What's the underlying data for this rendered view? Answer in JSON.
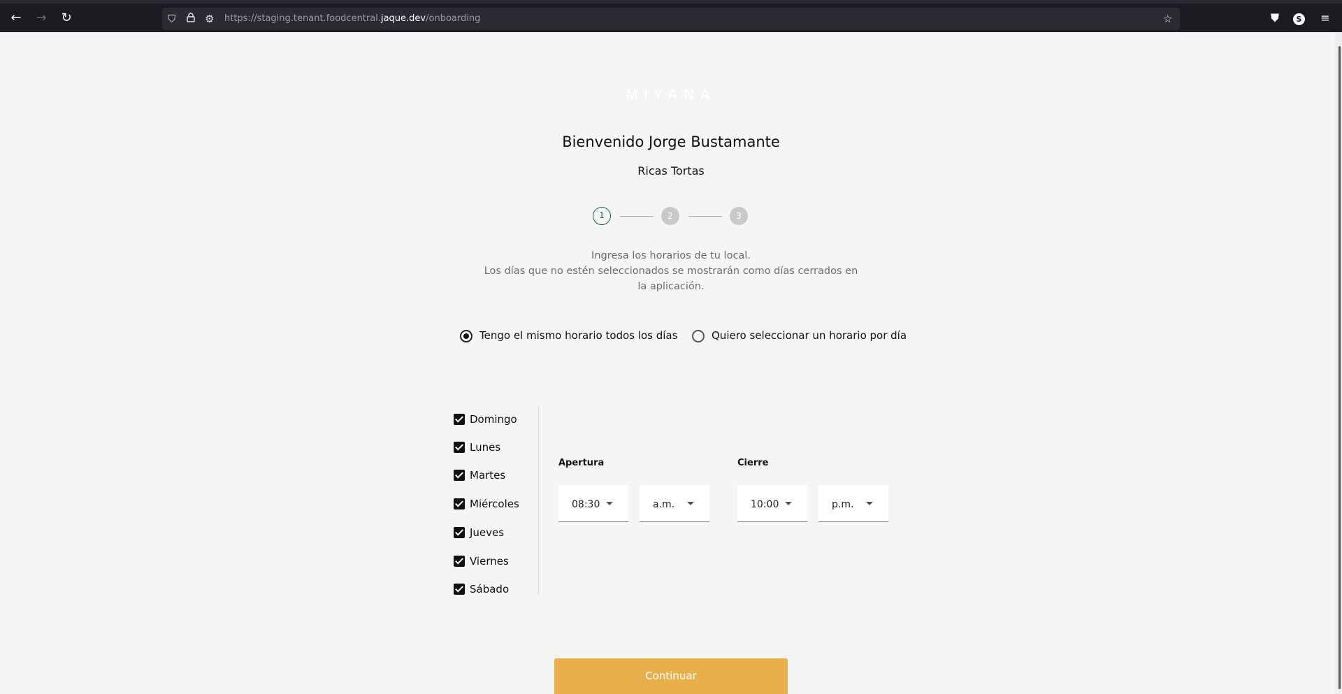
{
  "browser": {
    "url_prefix": "https://staging.tenant.foodcentral.",
    "url_domain": "jaque.dev",
    "url_path": "/onboarding",
    "profile_initial": "S"
  },
  "brand": {
    "logo_text": "MIYANA"
  },
  "header": {
    "title": "Bienvenido Jorge Bustamante",
    "subtitle": "Ricas Tortas"
  },
  "stepper": {
    "steps": [
      "1",
      "2",
      "3"
    ],
    "current": 1
  },
  "instructions": {
    "line1": "Ingresa los horarios de tu local.",
    "line2": "Los días que no estén seleccionados se mostrarán como días cerrados en la aplicación."
  },
  "schedule_mode": {
    "options": [
      {
        "label": "Tengo el mismo horario todos los días",
        "selected": true
      },
      {
        "label": "Quiero seleccionar un horario por día",
        "selected": false
      }
    ]
  },
  "days": [
    {
      "label": "Domingo",
      "checked": true
    },
    {
      "label": "Lunes",
      "checked": true
    },
    {
      "label": "Martes",
      "checked": true
    },
    {
      "label": "Miércoles",
      "checked": true
    },
    {
      "label": "Jueves",
      "checked": true
    },
    {
      "label": "Viernes",
      "checked": true
    },
    {
      "label": "Sábado",
      "checked": true
    }
  ],
  "hours": {
    "opening_label": "Apertura",
    "opening_time": "08:30",
    "opening_period": "a.m.",
    "closing_label": "Cierre",
    "closing_time": "10:00",
    "closing_period": "p.m."
  },
  "actions": {
    "continue_label": "Continuar"
  },
  "colors": {
    "accent": "#e8b04a",
    "step_active": "#1f5e57",
    "background": "#f5f5f5"
  }
}
